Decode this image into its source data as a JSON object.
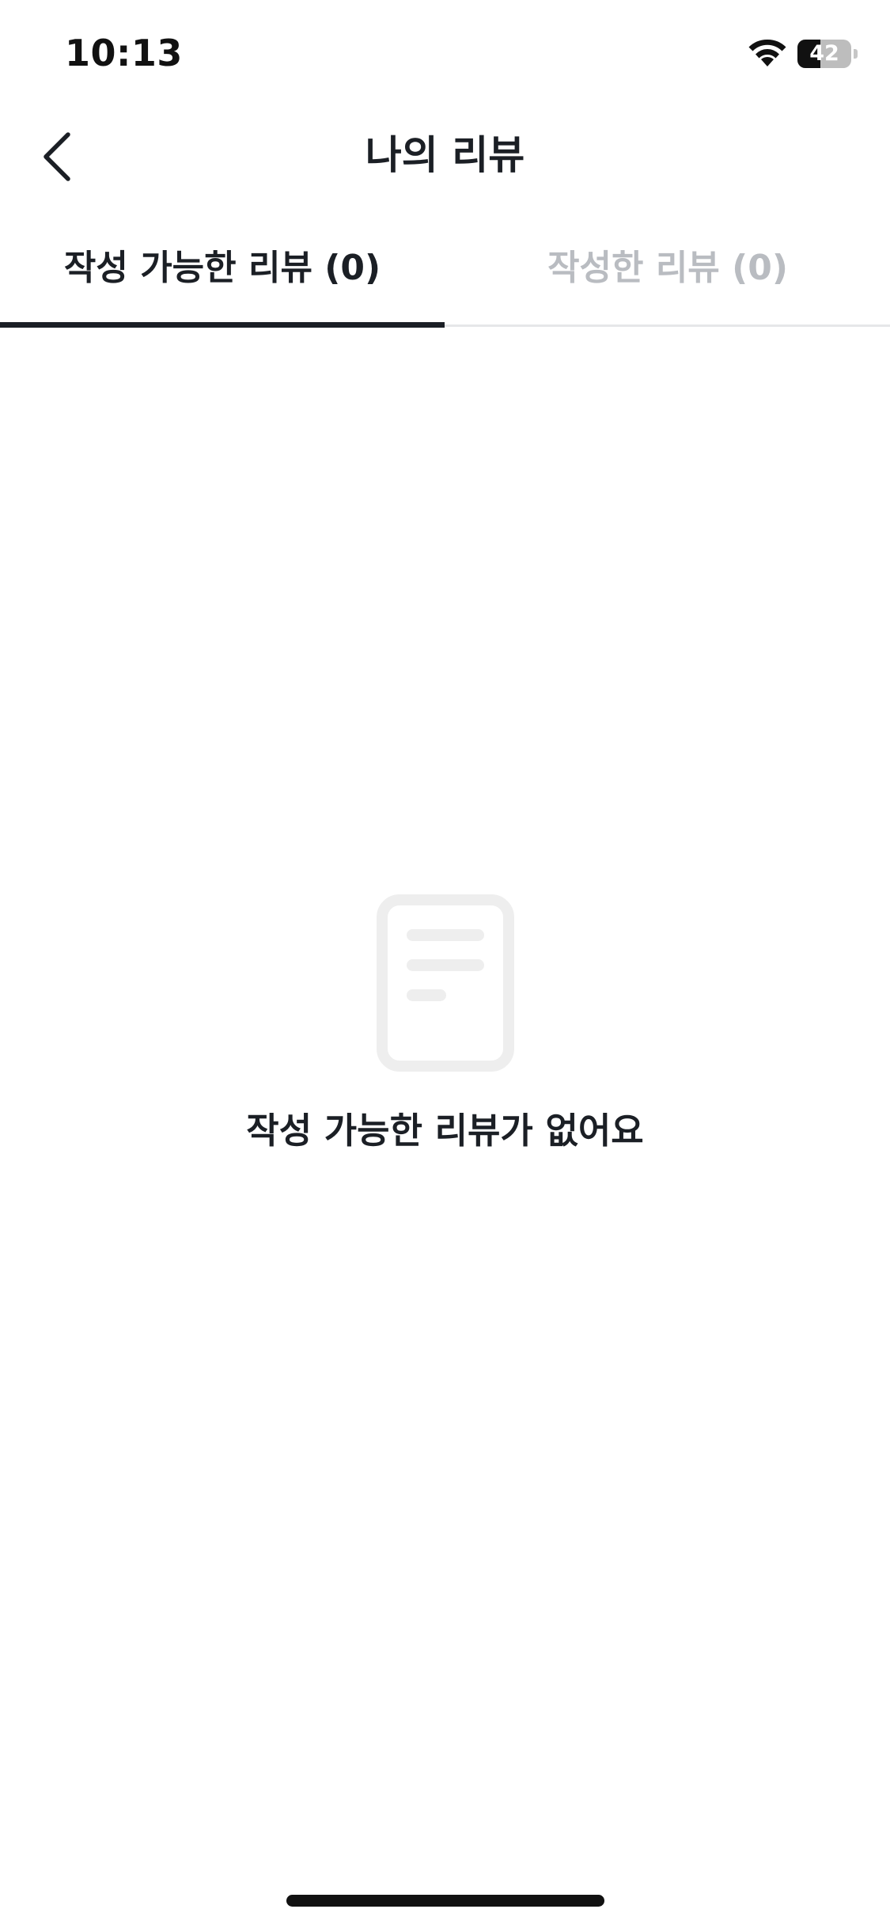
{
  "status_bar": {
    "time": "10:13",
    "battery_level": "42",
    "battery_fraction": 0.42,
    "icons": [
      "wifi-icon",
      "battery-icon"
    ]
  },
  "header": {
    "title": "나의 리뷰",
    "back_icon": "chevron-left-icon"
  },
  "tabs": [
    {
      "label": "작성 가능한 리뷰 (0)",
      "selected": true
    },
    {
      "label": "작성한 리뷰 (0)",
      "selected": false
    }
  ],
  "empty_state": {
    "icon": "document-icon",
    "message": "작성 가능한 리뷰가 없어요"
  },
  "colors": {
    "text_primary": "#1b1f25",
    "text_inactive": "#b9bcc1",
    "indicator": "#1b1f25",
    "divider": "#e6e7e9",
    "icon_gray": "#eeeeee",
    "background": "#ffffff"
  }
}
